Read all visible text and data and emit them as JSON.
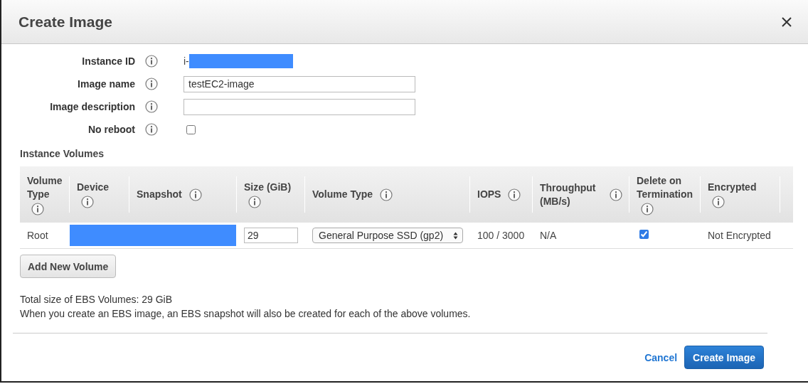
{
  "dialog": {
    "title": "Create Image"
  },
  "form": [
    {
      "kind": "text",
      "label": "Instance ID",
      "value": "i-"
    },
    {
      "kind": "input",
      "label": "Image name",
      "value": "testEC2-image"
    },
    {
      "kind": "input",
      "label": "Image description"
    },
    {
      "kind": "checkbox",
      "label": "No reboot",
      "checked": false
    }
  ],
  "volumes": {
    "heading": "Instance Volumes",
    "columns": [
      "Volume Type",
      "Device",
      "Snapshot",
      "Size (GiB)",
      "Volume Type",
      "IOPS",
      "Throughput (MB/s)",
      "Delete on Termination",
      "Encrypted"
    ],
    "rows": [
      {
        "volume_type": "Root",
        "size": "29",
        "type": "General Purpose SSD (gp2)",
        "iops": "100 / 3000",
        "throughput": "N/A",
        "delete_on_termination": true,
        "encrypted": "Not Encrypted"
      }
    ]
  },
  "add_button": "Add New Volume",
  "notes": [
    "Total size of EBS Volumes: 29 GiB",
    "When you create an EBS image, an EBS snapshot will also be created for each of the above volumes."
  ],
  "footer": {
    "cancel": "Cancel",
    "primary": "Create Image"
  }
}
